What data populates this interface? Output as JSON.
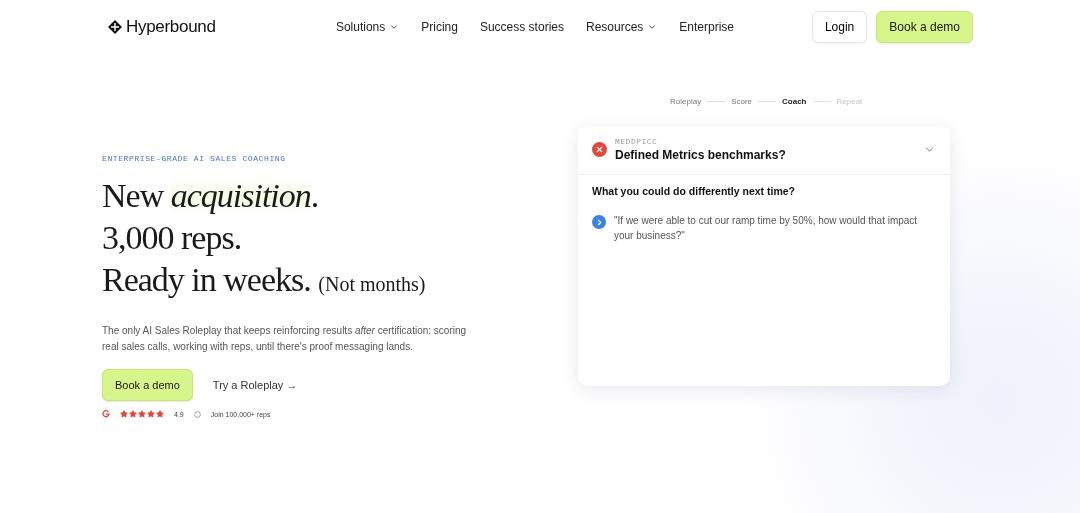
{
  "header": {
    "logo": "Hyperbound",
    "nav": [
      {
        "label": "Solutions",
        "dropdown": true
      },
      {
        "label": "Pricing",
        "dropdown": false
      },
      {
        "label": "Success stories",
        "dropdown": false
      },
      {
        "label": "Resources",
        "dropdown": true
      },
      {
        "label": "Enterprise",
        "dropdown": false
      }
    ],
    "login": "Login",
    "cta": "Book a demo"
  },
  "hero": {
    "eyebrow": "ENTERPRISE-GRADE AI SALES COACHING",
    "headline": [
      {
        "before": "New ",
        "emphasis": "acquisition",
        "after": "."
      },
      {
        "before": "3,000 reps."
      },
      {
        "before": "Ready in weeks.",
        "note": "(Not months)"
      }
    ],
    "description": "The only AI Sales Roleplay that keeps reinforcing results *after* certification: scoring real sales calls, working with reps, until there's proof messaging lands.",
    "primary": "Book a demo",
    "secondary": "Try a Roleplay →",
    "rating": {
      "stars": 5,
      "score": "4.9"
    },
    "community": "Join 100,000+ reps"
  },
  "steps": [
    {
      "label": "Roleplay",
      "selected": false,
      "completed": true
    },
    {
      "label": "Score",
      "selected": false,
      "completed": true
    },
    {
      "label": "Coach",
      "selected": true,
      "completed": false
    },
    {
      "label": "Repeat",
      "selected": false,
      "completed": false
    }
  ],
  "card": {
    "tag": "MEDDPICC",
    "title": "Defined Metrics benchmarks?",
    "passed": false,
    "expanded": true,
    "question": "What you could do differently next time?",
    "suggestion": "\"If we were able to cut our ramp time by 50%, how would that impact your business?\""
  }
}
